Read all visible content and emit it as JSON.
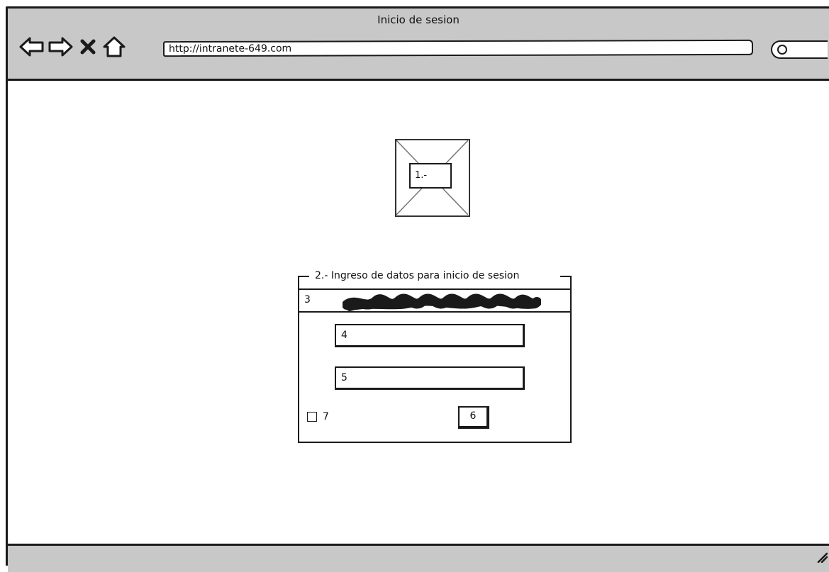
{
  "window": {
    "title": "Inicio de sesion",
    "url": "http://intranete-649.com"
  },
  "nav": {
    "back_icon": "back-arrow-icon",
    "forward_icon": "forward-arrow-icon",
    "stop_icon": "close-icon",
    "home_icon": "home-icon",
    "search_icon": "search-icon"
  },
  "content": {
    "image_label": "1.-",
    "form_legend": "2.- Ingreso de datos para inicio de sesion",
    "row3_label": "3",
    "field4_label": "4",
    "field5_label": "5",
    "button6_label": "6",
    "checkbox7_label": "7",
    "checkbox7_checked": false
  }
}
